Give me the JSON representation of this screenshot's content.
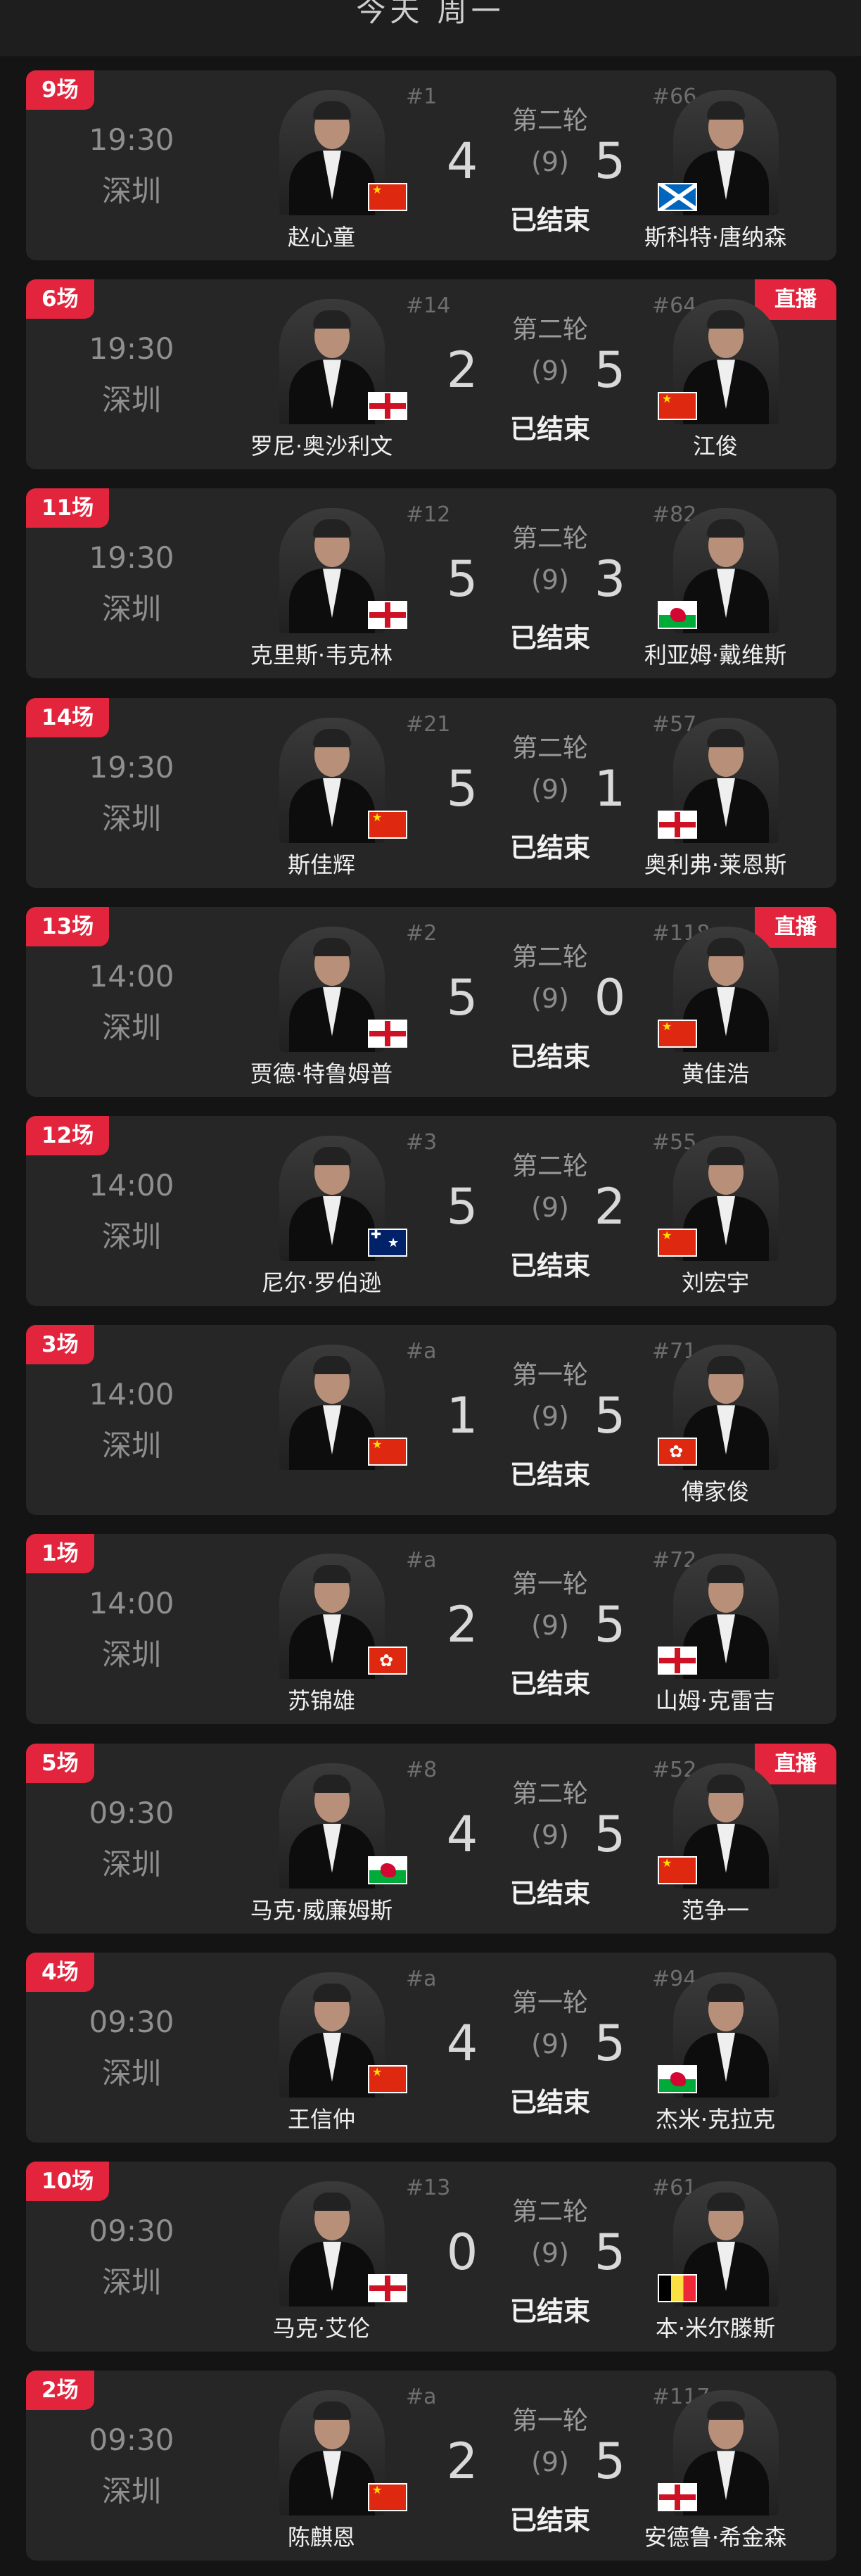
{
  "header": {
    "title": "今天 周一"
  },
  "colors": {
    "accent": "#e2243d",
    "card": "#262626",
    "background": "#141414"
  },
  "matches": [
    {
      "tag": "9场",
      "live": "",
      "time": "19:30",
      "venue": "深圳",
      "round": "第二轮",
      "status": "已结束",
      "best_of": "(9)",
      "p1": {
        "name": "赵心童",
        "rank": "#1",
        "flag": "cn"
      },
      "s1": "4",
      "p2": {
        "name": "斯科特·唐纳森",
        "rank": "#66",
        "flag": "sco"
      },
      "s2": "5"
    },
    {
      "tag": "6场",
      "live": "直播",
      "time": "19:30",
      "venue": "深圳",
      "round": "第二轮",
      "status": "已结束",
      "best_of": "(9)",
      "p1": {
        "name": "罗尼·奥沙利文",
        "rank": "#14",
        "flag": "en"
      },
      "s1": "2",
      "p2": {
        "name": "江俊",
        "rank": "#64",
        "flag": "cn"
      },
      "s2": "5"
    },
    {
      "tag": "11场",
      "live": "",
      "time": "19:30",
      "venue": "深圳",
      "round": "第二轮",
      "status": "已结束",
      "best_of": "(9)",
      "p1": {
        "name": "克里斯·韦克林",
        "rank": "#12",
        "flag": "en"
      },
      "s1": "5",
      "p2": {
        "name": "利亚姆·戴维斯",
        "rank": "#82",
        "flag": "wal"
      },
      "s2": "3"
    },
    {
      "tag": "14场",
      "live": "",
      "time": "19:30",
      "venue": "深圳",
      "round": "第二轮",
      "status": "已结束",
      "best_of": "(9)",
      "p1": {
        "name": "斯佳辉",
        "rank": "#21",
        "flag": "cn"
      },
      "s1": "5",
      "p2": {
        "name": "奥利弗·莱恩斯",
        "rank": "#57",
        "flag": "en"
      },
      "s2": "1"
    },
    {
      "tag": "13场",
      "live": "直播",
      "time": "14:00",
      "venue": "深圳",
      "round": "第二轮",
      "status": "已结束",
      "best_of": "(9)",
      "p1": {
        "name": "贾德·特鲁姆普",
        "rank": "#2",
        "flag": "en"
      },
      "s1": "5",
      "p2": {
        "name": "黄佳浩",
        "rank": "#118",
        "flag": "cn"
      },
      "s2": "0"
    },
    {
      "tag": "12场",
      "live": "",
      "time": "14:00",
      "venue": "深圳",
      "round": "第二轮",
      "status": "已结束",
      "best_of": "(9)",
      "p1": {
        "name": "尼尔·罗伯逊",
        "rank": "#3",
        "flag": "aus"
      },
      "s1": "5",
      "p2": {
        "name": "刘宏宇",
        "rank": "#55",
        "flag": "cn"
      },
      "s2": "2"
    },
    {
      "tag": "3场",
      "live": "",
      "time": "14:00",
      "venue": "深圳",
      "round": "第一轮",
      "status": "已结束",
      "best_of": "(9)",
      "p1": {
        "name": "",
        "rank": "#a",
        "flag": "cn"
      },
      "s1": "1",
      "p2": {
        "name": "傅家俊",
        "rank": "#71",
        "flag": "hk"
      },
      "s2": "5"
    },
    {
      "tag": "1场",
      "live": "",
      "time": "14:00",
      "venue": "深圳",
      "round": "第一轮",
      "status": "已结束",
      "best_of": "(9)",
      "p1": {
        "name": "苏锦雄",
        "rank": "#a",
        "flag": "hk"
      },
      "s1": "2",
      "p2": {
        "name": "山姆·克雷吉",
        "rank": "#72",
        "flag": "en"
      },
      "s2": "5"
    },
    {
      "tag": "5场",
      "live": "直播",
      "time": "09:30",
      "venue": "深圳",
      "round": "第二轮",
      "status": "已结束",
      "best_of": "(9)",
      "p1": {
        "name": "马克·威廉姆斯",
        "rank": "#8",
        "flag": "wal"
      },
      "s1": "4",
      "p2": {
        "name": "范争一",
        "rank": "#52",
        "flag": "cn"
      },
      "s2": "5"
    },
    {
      "tag": "4场",
      "live": "",
      "time": "09:30",
      "venue": "深圳",
      "round": "第一轮",
      "status": "已结束",
      "best_of": "(9)",
      "p1": {
        "name": "王信仲",
        "rank": "#a",
        "flag": "cn"
      },
      "s1": "4",
      "p2": {
        "name": "杰米·克拉克",
        "rank": "#94",
        "flag": "wal"
      },
      "s2": "5"
    },
    {
      "tag": "10场",
      "live": "",
      "time": "09:30",
      "venue": "深圳",
      "round": "第二轮",
      "status": "已结束",
      "best_of": "(9)",
      "p1": {
        "name": "马克·艾伦",
        "rank": "#13",
        "flag": "en"
      },
      "s1": "0",
      "p2": {
        "name": "本·米尔滕斯",
        "rank": "#61",
        "flag": "bel"
      },
      "s2": "5"
    },
    {
      "tag": "2场",
      "live": "",
      "time": "09:30",
      "venue": "深圳",
      "round": "第一轮",
      "status": "已结束",
      "best_of": "(9)",
      "p1": {
        "name": "陈麒恩",
        "rank": "#a",
        "flag": "cn"
      },
      "s1": "2",
      "p2": {
        "name": "安德鲁·希金森",
        "rank": "#117",
        "flag": "en"
      },
      "s2": "5"
    }
  ]
}
